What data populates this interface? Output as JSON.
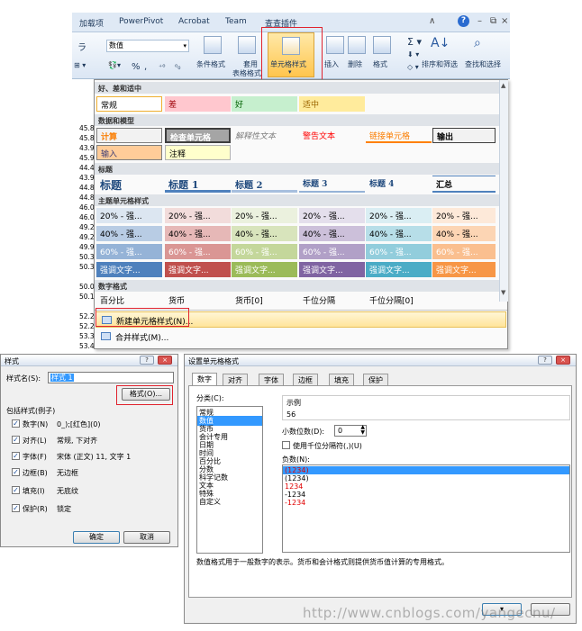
{
  "ribbon": {
    "tabs": [
      "加载项",
      "PowerPivot",
      "Acrobat",
      "Team",
      "查查插件"
    ],
    "number_format_value": "数值",
    "percent_symbol": "%",
    "comma_symbol": ",",
    "groups": {
      "conditional_format": "条件格式",
      "table_format_line1": "套用",
      "table_format_line2": "表格格式",
      "cell_styles": "单元格样式",
      "insert": "插入",
      "delete": "删除",
      "format": "格式",
      "sort_filter": "排序和筛选",
      "find_select": "查找和选择"
    }
  },
  "sheet": {
    "rows": [
      "45.8",
      "45.8",
      "43.9",
      "45.9",
      "44.4",
      "43.9",
      "44.8",
      "44.8",
      "46.0",
      "46.0",
      "49.2",
      "49.2",
      "49.9",
      "50.3",
      "50.3",
      "50.0",
      "50.1",
      "52.2",
      "52.2",
      "53.3",
      "53.4"
    ]
  },
  "gallery": {
    "sections": {
      "good_bad": "好、差和适中",
      "data_model": "数据和模型",
      "titles": "标题",
      "theme": "主题单元格样式",
      "number": "数字格式"
    },
    "good_bad": [
      "常规",
      "差",
      "好",
      "适中"
    ],
    "data_model_row1": [
      "计算",
      "检查单元格",
      "解释性文本",
      "警告文本",
      "链接单元格",
      "输出"
    ],
    "data_model_row2": [
      "输入",
      "注释"
    ],
    "titles": [
      "标题",
      "标题 1",
      "标题 2",
      "标题 3",
      "标题 4",
      "汇总"
    ],
    "theme_20": [
      "20% - 强...",
      "20% - 强...",
      "20% - 强...",
      "20% - 强...",
      "20% - 强...",
      "20% - 强..."
    ],
    "theme_40": [
      "40% - 强...",
      "40% - 强...",
      "40% - 强...",
      "40% - 强...",
      "40% - 强...",
      "40% - 强..."
    ],
    "theme_60": [
      "60% - 强...",
      "60% - 强...",
      "60% - 强...",
      "60% - 强...",
      "60% - 强...",
      "60% - 强..."
    ],
    "theme_accent": [
      "强调文字...",
      "强调文字...",
      "强调文字...",
      "强调文字...",
      "强调文字...",
      "强调文字..."
    ],
    "number_formats": [
      "百分比",
      "货币",
      "货币[0]",
      "千位分隔",
      "千位分隔[0]"
    ],
    "menu_new_style": "新建单元格样式(N)...",
    "menu_merge_style": "合并样式(M)..."
  },
  "style_dialog": {
    "title": "样式",
    "style_name_label": "样式名(S):",
    "style_name_value": "样式 1",
    "format_button": "格式(O)...",
    "includes_label": "包括样式(例子)",
    "items": [
      {
        "label": "数字(N)",
        "value": "0_);[红色](0)",
        "checked": true
      },
      {
        "label": "对齐(L)",
        "value": "常规, 下对齐",
        "checked": true
      },
      {
        "label": "字体(F)",
        "value": "宋体 (正文) 11, 文字 1",
        "checked": true
      },
      {
        "label": "边框(B)",
        "value": "无边框",
        "checked": true
      },
      {
        "label": "填充(I)",
        "value": "无底纹",
        "checked": true
      },
      {
        "label": "保护(R)",
        "value": "锁定",
        "checked": true
      }
    ],
    "ok_button": "确定",
    "cancel_button": "取消",
    "help_btn": "?",
    "close_btn": "×"
  },
  "format_dialog": {
    "title": "设置单元格格式",
    "tabs": [
      "数字",
      "对齐",
      "字体",
      "边框",
      "填充",
      "保护"
    ],
    "category_label": "分类(C):",
    "categories": [
      "常规",
      "数值",
      "货币",
      "会计专用",
      "日期",
      "时间",
      "百分比",
      "分数",
      "科学记数",
      "文本",
      "特殊",
      "自定义"
    ],
    "selected_category": "数值",
    "sample_label": "示例",
    "sample_value": "56",
    "decimal_label": "小数位数(D):",
    "decimal_value": "0",
    "thousands_label": "使用千位分隔符(,)(U)",
    "negative_label": "负数(N):",
    "negatives": [
      {
        "text": "(1234)",
        "color": "#e00000",
        "selected": true
      },
      {
        "text": "(1234)",
        "color": "#000000",
        "selected": false
      },
      {
        "text": "1234",
        "color": "#e00000",
        "selected": false
      },
      {
        "text": "-1234",
        "color": "#000000",
        "selected": false
      },
      {
        "text": "-1234",
        "color": "#e00000",
        "selected": false
      }
    ],
    "description": "数值格式用于一般数字的表示。货币和会计格式则提供货币值计算的专用格式。",
    "help_btn": "?",
    "close_btn": "×"
  },
  "watermark": "http://www.cnblogs.com/yangecnu/",
  "colors": {
    "highlight_red": "#e0232e",
    "selection_blue": "#3399ff",
    "ribbon_blue": "#dfe9f5"
  }
}
